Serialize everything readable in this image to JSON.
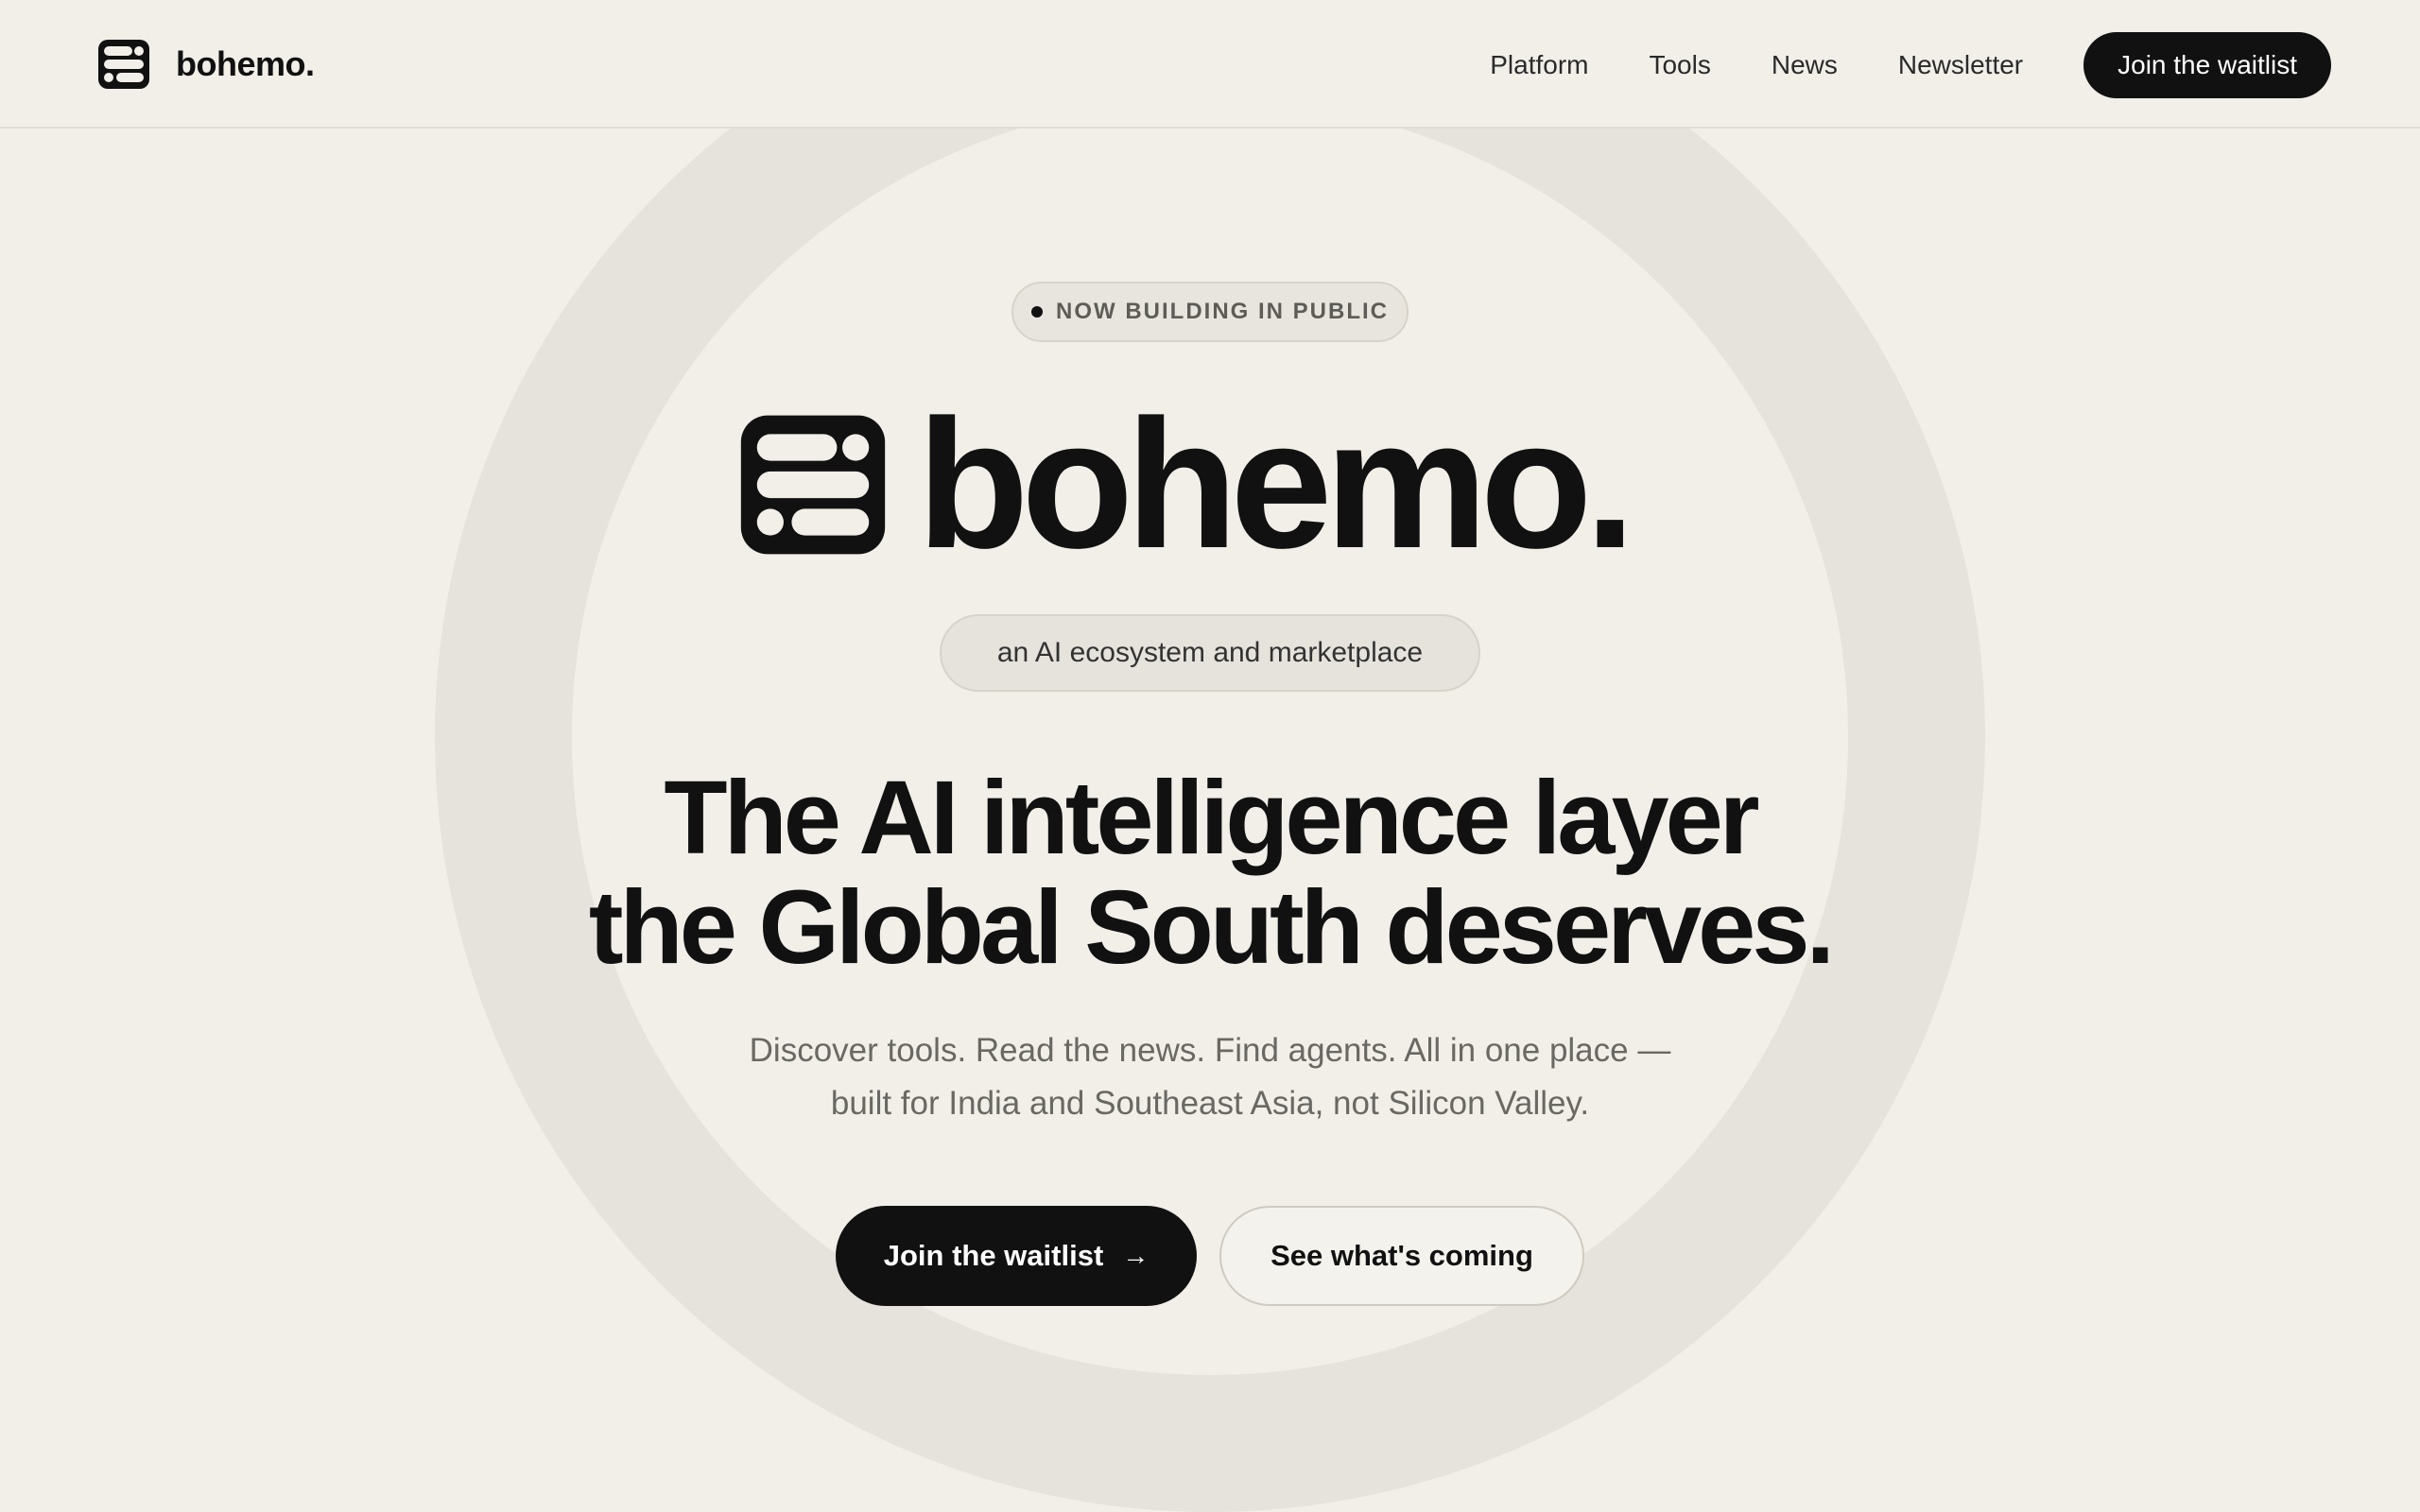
{
  "header": {
    "brand_name": "bohemo.",
    "logo_icon": "stacked-bars-logo-icon",
    "nav": [
      {
        "label": "Platform"
      },
      {
        "label": "Tools"
      },
      {
        "label": "News"
      },
      {
        "label": "Newsletter"
      }
    ],
    "cta_label": "Join the waitlist"
  },
  "hero": {
    "status_badge": "NOW BUILDING IN PUBLIC",
    "logo_text": "bohemo.",
    "tagline": "an AI ecosystem and marketplace",
    "headline_line1": "The AI intelligence layer",
    "headline_line2": "the Global South deserves.",
    "subcopy_line1": "Discover tools. Read the news. Find agents. All in one place —",
    "subcopy_line2": "built for India and Southeast Asia, not Silicon Valley.",
    "primary_cta": "Join the waitlist",
    "primary_cta_arrow": "→",
    "secondary_cta": "See what's coming"
  },
  "colors": {
    "background": "#f1efe8",
    "ink": "#111111",
    "muted_text": "#6a6863",
    "pill_bg": "#e6e3dc",
    "ring": "#e6e3dc"
  }
}
